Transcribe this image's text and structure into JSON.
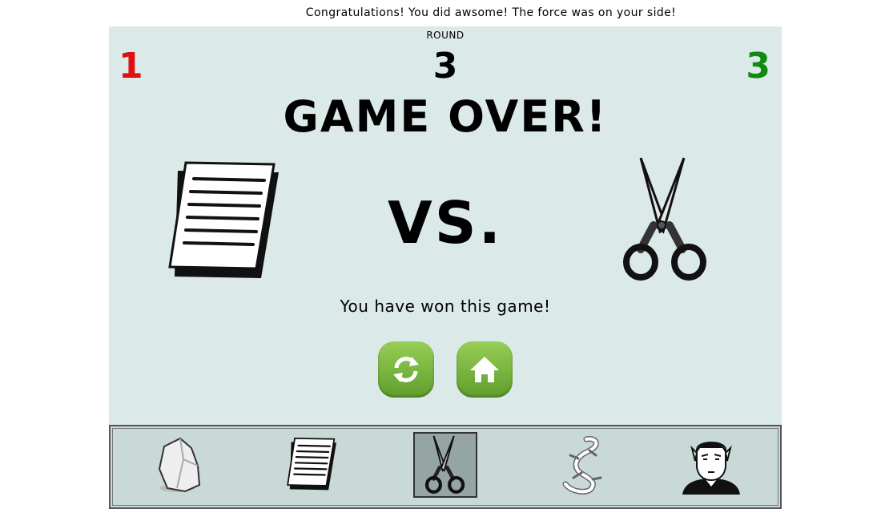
{
  "banner": "Congratulations! You did awsome! The force was on your side!",
  "round": {
    "label": "ROUND",
    "number": "3"
  },
  "scores": {
    "player": "1",
    "computer": "3",
    "player_color": "#e01010",
    "computer_color": "#128a12"
  },
  "title": "GAME OVER!",
  "vs": "VS.",
  "player_choice": "paper",
  "computer_choice": "scissors",
  "result": "You have won this game!",
  "buttons": {
    "replay_icon": "replay-icon",
    "home_icon": "home-icon"
  },
  "choices": [
    "rock",
    "paper",
    "scissors",
    "lizard",
    "spock"
  ],
  "selected_choice": "scissors"
}
